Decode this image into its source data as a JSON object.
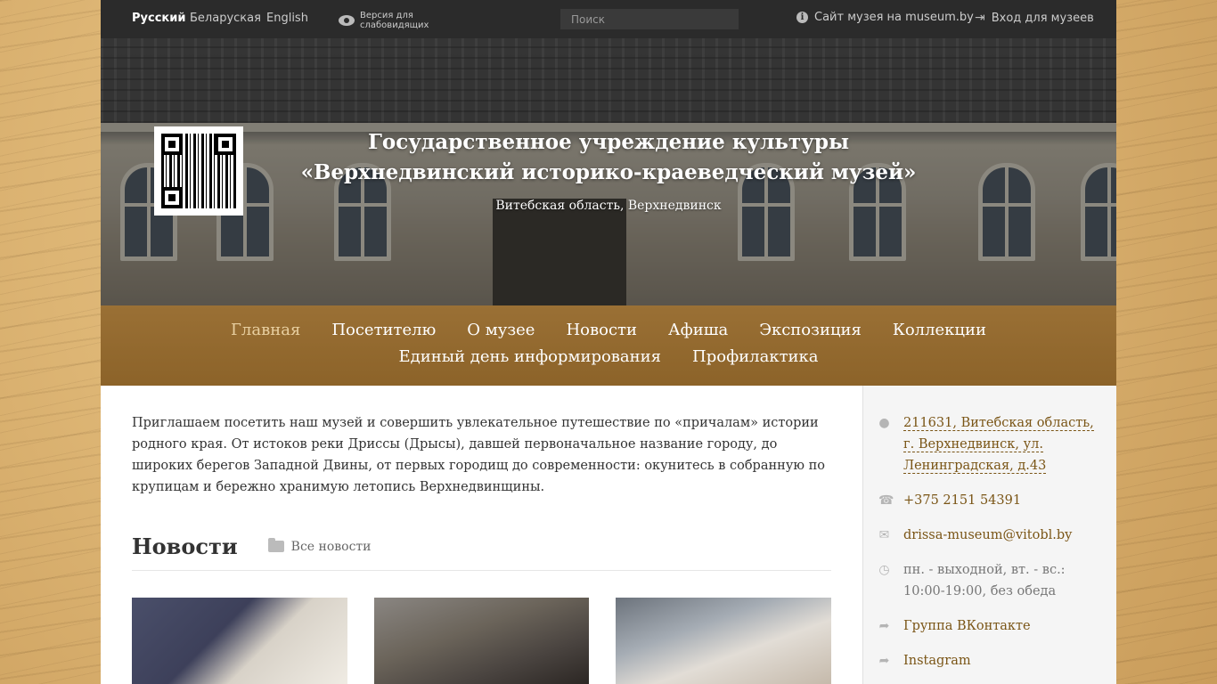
{
  "topbar": {
    "languages": [
      "Русский",
      "Беларуская",
      "English"
    ],
    "low_vision": "Версия для слабовидящих",
    "search_placeholder": "Поиск",
    "museum_site": "Сайт музея на museum.by",
    "login": "Вход для музеев"
  },
  "hero": {
    "title_line1": "Государственное учреждение культуры",
    "title_line2": "«Верхнедвинский историко-краеведческий музей»",
    "subtitle": "Витебская область, Верхнедвинск"
  },
  "nav": {
    "row1": [
      "Главная",
      "Посетителю",
      "О музее",
      "Новости",
      "Афиша",
      "Экспозиция",
      "Коллекции"
    ],
    "row2": [
      "Единый день информирования",
      "Профилактика"
    ]
  },
  "main": {
    "intro": "Приглашаем посетить наш музей и совершить увлекательное путешествие по «причалам» истории родного края. От истоков реки Дриссы (Дрысы), давшей первоначальное название городу, до широких берегов Западной Двины, от первых городищ до современности: окунитесь в собранную по крупицам и бережно хранимую летопись Верхнедвинщины.",
    "news_title": "Новости",
    "all_news": "Все новости"
  },
  "sidebar": {
    "address": "211631, Витебская область, г. Верхнедвинск, ул. Ленинградская, д.43",
    "phone": "+375 2151 54391",
    "email": "drissa-museum@vitobl.by",
    "hours": "пн. - выходной, вт. - вс.: 10:00-19:00, без обеда",
    "vk": "Группа ВКонтакте",
    "instagram": "Instagram"
  }
}
